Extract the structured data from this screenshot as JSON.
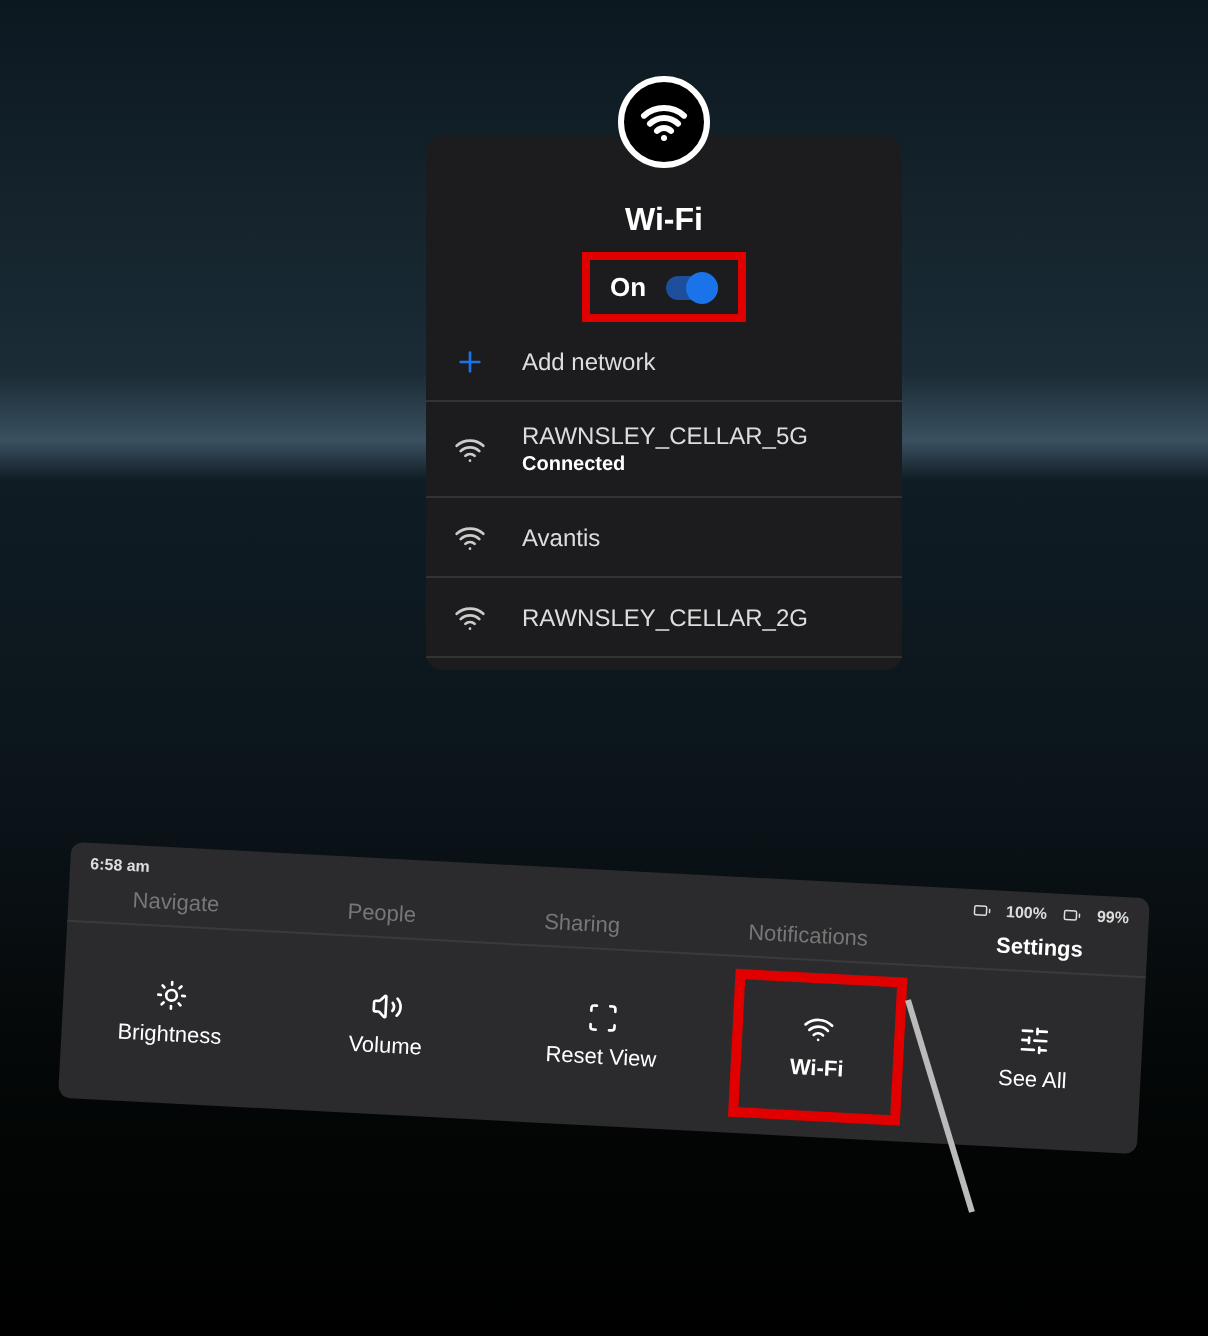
{
  "wifi_panel": {
    "title": "Wi-Fi",
    "toggle": {
      "label": "On",
      "on": true,
      "highlighted": true
    },
    "add_network": {
      "label": "Add network"
    },
    "networks": [
      {
        "name": "RAWNSLEY_CELLAR_5G",
        "status": "Connected"
      },
      {
        "name": "Avantis"
      },
      {
        "name": "RAWNSLEY_CELLAR_2G"
      }
    ]
  },
  "dock": {
    "time": "6:58 am",
    "batteries": [
      "100%",
      "99%"
    ],
    "tabs": [
      {
        "label": "Navigate",
        "selected": false
      },
      {
        "label": "People",
        "selected": false
      },
      {
        "label": "Sharing",
        "selected": false
      },
      {
        "label": "Notifications",
        "selected": false
      },
      {
        "label": "Settings",
        "selected": true
      }
    ],
    "tiles": [
      {
        "kind": "brightness",
        "label": "Brightness",
        "selected": false
      },
      {
        "kind": "volume",
        "label": "Volume",
        "selected": false
      },
      {
        "kind": "reset",
        "label": "Reset View",
        "selected": false
      },
      {
        "kind": "wifi",
        "label": "Wi-Fi",
        "selected": true
      },
      {
        "kind": "all",
        "label": "See All",
        "selected": false
      }
    ]
  }
}
